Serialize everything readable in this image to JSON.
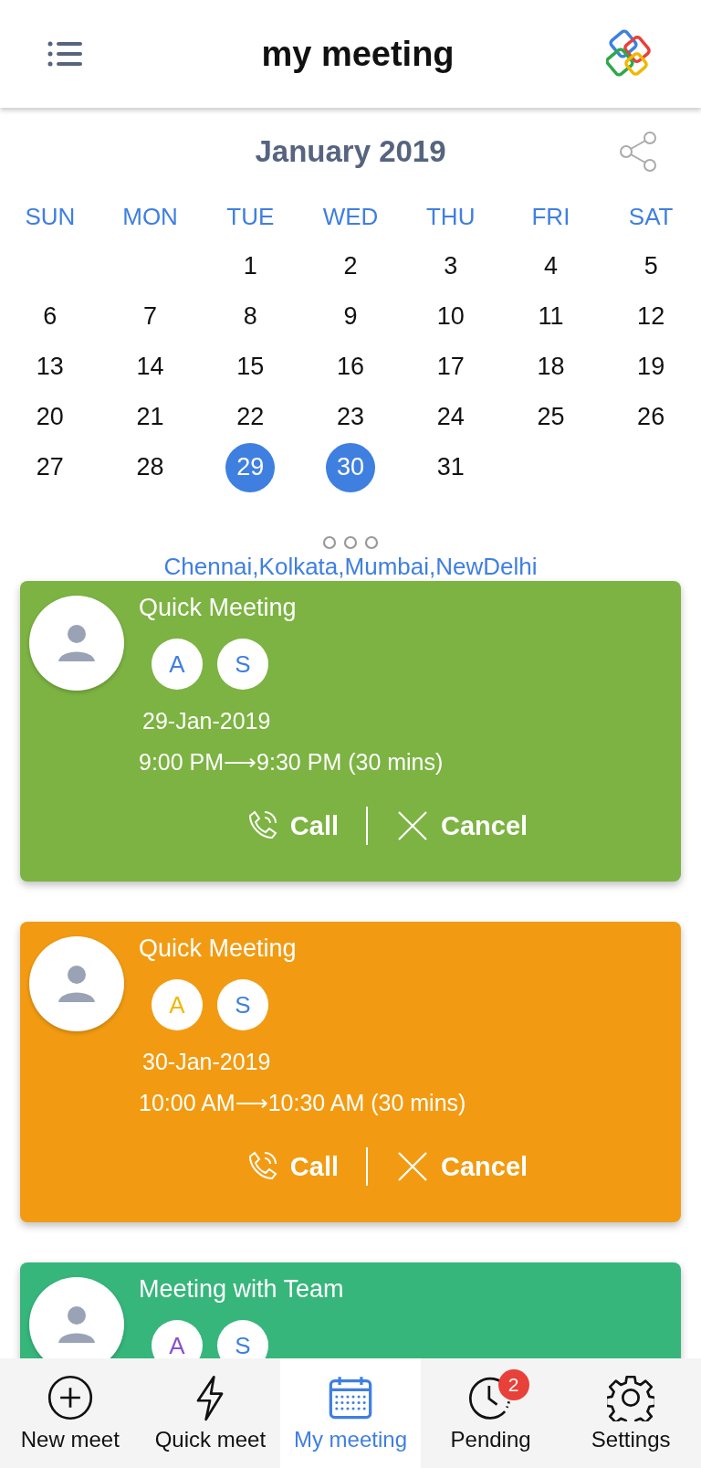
{
  "header": {
    "title": "my meeting"
  },
  "calendar": {
    "month": "January 2019",
    "weekdays": [
      "SUN",
      "MON",
      "TUE",
      "WED",
      "THU",
      "FRI",
      "SAT"
    ],
    "weeks": [
      [
        {
          "day": "1",
          "selected": false
        },
        {
          "day": "2",
          "selected": false
        },
        {
          "day": "3",
          "selected": false
        },
        {
          "day": "4",
          "selected": false
        },
        {
          "day": "5",
          "selected": false
        }
      ],
      [
        {
          "day": "6",
          "selected": false
        },
        {
          "day": "7",
          "selected": false
        },
        {
          "day": "8",
          "selected": false
        },
        {
          "day": "9",
          "selected": false
        },
        {
          "day": "10",
          "selected": false
        },
        {
          "day": "11",
          "selected": false
        },
        {
          "day": "12",
          "selected": false
        }
      ],
      [
        {
          "day": "13",
          "selected": false
        },
        {
          "day": "14",
          "selected": false
        },
        {
          "day": "15",
          "selected": false
        },
        {
          "day": "16",
          "selected": false
        },
        {
          "day": "17",
          "selected": false
        },
        {
          "day": "18",
          "selected": false
        },
        {
          "day": "19",
          "selected": false
        }
      ],
      [
        {
          "day": "20",
          "selected": false
        },
        {
          "day": "21",
          "selected": false
        },
        {
          "day": "22",
          "selected": false
        },
        {
          "day": "23",
          "selected": false
        },
        {
          "day": "24",
          "selected": false
        },
        {
          "day": "25",
          "selected": false
        },
        {
          "day": "26",
          "selected": false
        }
      ],
      [
        {
          "day": "27",
          "selected": false
        },
        {
          "day": "28",
          "selected": false
        },
        {
          "day": "29",
          "selected": true
        },
        {
          "day": "30",
          "selected": true
        },
        {
          "day": "31",
          "selected": false
        }
      ]
    ]
  },
  "locations": "Chennai,Kolkata,Mumbai,NewDelhi",
  "meetings": [
    {
      "title": "Quick Meeting",
      "color": "#7cb342",
      "participants": [
        {
          "initial": "A",
          "color": "#3f7fe0"
        },
        {
          "initial": "S",
          "color": "#3f7fe0"
        }
      ],
      "date": "29-Jan-2019",
      "time": "9:00 PM⟶9:30 PM (30 mins)",
      "call": "Call",
      "cancel": "Cancel"
    },
    {
      "title": "Quick Meeting",
      "color": "#f29b12",
      "participants": [
        {
          "initial": "A",
          "color": "#f2b705"
        },
        {
          "initial": "S",
          "color": "#3f7fe0"
        }
      ],
      "date": "30-Jan-2019",
      "time": "10:00 AM⟶10:30 AM (30 mins)",
      "call": "Call",
      "cancel": "Cancel"
    },
    {
      "title": "Meeting with Team",
      "color": "#36b67b",
      "participants": [
        {
          "initial": "A",
          "color": "#8a4fd0"
        },
        {
          "initial": "S",
          "color": "#3f7fe0"
        }
      ]
    }
  ],
  "nav": [
    {
      "kind": "plus",
      "label": "New meet",
      "selected": false
    },
    {
      "kind": "bolt",
      "label": "Quick meet",
      "selected": false
    },
    {
      "kind": "calendar",
      "label": "My meeting",
      "selected": true
    },
    {
      "kind": "clock",
      "label": "Pending",
      "selected": false,
      "badge": "2"
    },
    {
      "kind": "gear",
      "label": "Settings",
      "selected": false
    }
  ]
}
